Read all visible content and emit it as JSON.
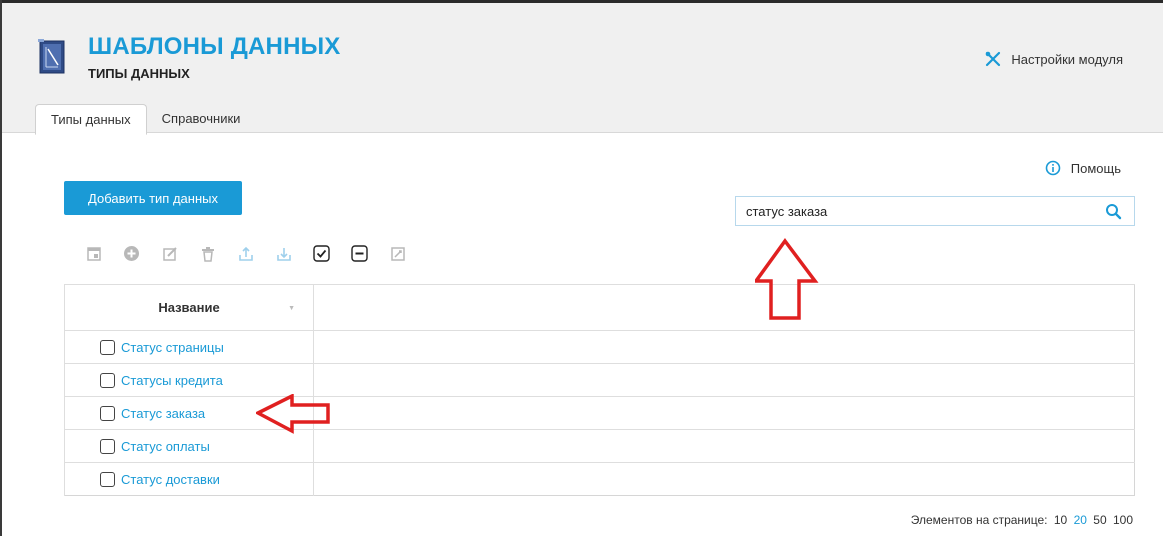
{
  "header": {
    "title": "ШАБЛОНЫ ДАННЫХ",
    "subtitle": "ТИПЫ ДАННЫХ",
    "settings_label": "Настройки модуля",
    "settings_icon": "wrench-screwdriver-icon",
    "module_icon": "blueprint-ruler-icon"
  },
  "tabs": [
    {
      "label": "Типы данных",
      "active": true
    },
    {
      "label": "Справочники",
      "active": false
    }
  ],
  "help": {
    "label": "Помощь",
    "icon": "info-icon"
  },
  "actions": {
    "add_label": "Добавить тип данных"
  },
  "search": {
    "value": "статус заказа",
    "icon": "search-icon"
  },
  "toolbar": [
    "open-icon",
    "add-icon",
    "edit-icon",
    "delete-icon",
    "export-icon",
    "import-icon",
    "select-all-icon",
    "deselect-icon",
    "settings-icon"
  ],
  "table": {
    "columns": [
      "Название",
      ""
    ],
    "rows": [
      {
        "name": "Статус страницы"
      },
      {
        "name": "Статусы кредита"
      },
      {
        "name": "Статус заказа"
      },
      {
        "name": "Статус оплаты"
      },
      {
        "name": "Статус доставки"
      }
    ]
  },
  "pager": {
    "label": "Элементов на странице:",
    "sizes": [
      "10",
      "20",
      "50",
      "100"
    ],
    "current": "20"
  },
  "colors": {
    "accent": "#1a9ad6",
    "annotation": "#e02020"
  }
}
